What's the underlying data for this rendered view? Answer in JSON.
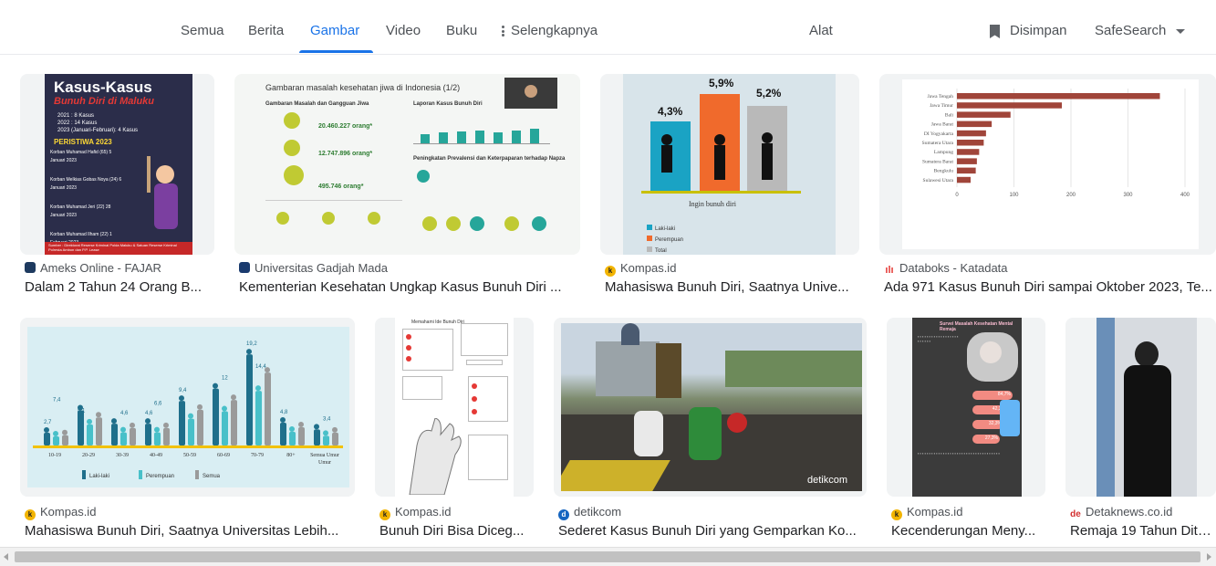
{
  "tabs": [
    {
      "label": "Semua"
    },
    {
      "label": "Berita"
    },
    {
      "label": "Gambar"
    },
    {
      "label": "Video"
    },
    {
      "label": "Buku"
    },
    {
      "label": "Selengkapnya"
    }
  ],
  "tools_label": "Alat",
  "saved_label": "Disimpan",
  "safesearch_label": "SafeSearch",
  "results": [
    {
      "source": "Ameks Online - FAJAR",
      "title": "Dalam 2 Tahun 24 Orang B...",
      "thumb": {
        "heading": "Kasus-Kasus",
        "subheading": "Bunuh Diri di Maluku",
        "lines": [
          "2021 : 8 Kasus",
          "2022 : 14 Kasus",
          "2023 (Januari-Februari): 4 Kasus"
        ],
        "event": "PERISTIWA 2023",
        "items": [
          "Korban Muhamad Hafid (65) 5 Januari 2023",
          "Korban Melkias Gobas Noya (24) 6 Januari 2023",
          "Korban Muhamad Jeri (22) 28 Januari 2023",
          "Korban Muhamad Ilham (22) 1 Februari 2023"
        ],
        "footer": "Sumber : Direktorat Reserse Kriminal Polda Maluku & Satuan Reserse Kriminal Polresta Ambon dan P.P. Lease"
      }
    },
    {
      "source": "Universitas Gadjah Mada",
      "title": "Kementerian Kesehatan Ungkap Kasus Bunuh Diri ...",
      "thumb": {
        "heading": "Gambaran masalah kesehatan jiwa di Indonesia (1/2)",
        "left_title": "Gambaran Masalah dan Gangguan Jiwa",
        "right_title": "Laporan Kasus Bunuh Diri",
        "n1": "20.460.227 orang*",
        "n2": "12.747.896 orang*",
        "n3": "495.746 orang*",
        "mid_title": "Peningkatan Prevalensi dan Keterpaparan terhadap Napza"
      }
    },
    {
      "source": "Kompas.id",
      "title": "Mahasiswa Bunuh Diri, Saatnya Unive...",
      "thumb": {
        "v1": "4,3%",
        "v2": "5,9%",
        "v3": "5,2%",
        "caption": "Ingin bunuh diri",
        "legend": [
          "Laki-laki",
          "Perempuan",
          "Total"
        ]
      }
    },
    {
      "source": "Databoks - Katadata",
      "title": "Ada 971 Kasus Bunuh Diri sampai Oktober 2023, Te...",
      "thumb": {
        "categories": [
          "Jawa Tengah",
          "Jawa Timur",
          "Bali",
          "Jawa Barat",
          "DI Yogyakarta",
          "Sumatera Utara",
          "Lampung",
          "Sumatera Barat",
          "Bengkulu",
          "Sulawesi Utara"
        ],
        "values": [
          356,
          184,
          94,
          61,
          51,
          47,
          39,
          35,
          33,
          24
        ],
        "ticks": [
          "0",
          "100",
          "200",
          "300",
          "400"
        ]
      }
    },
    {
      "source": "Kompas.id",
      "title": "Mahasiswa Bunuh Diri, Saatnya Universitas Lebih...",
      "thumb": {
        "groups": [
          "10-19",
          "20-29",
          "30-39",
          "40-49",
          "50-59",
          "60-69",
          "70-79",
          "80+",
          "Semua Umur"
        ],
        "labels": [
          "2,7",
          "7,4",
          "5,1",
          "4,6",
          "4,6",
          "6,6",
          "9,4",
          "12",
          "19,2",
          "14,4",
          "4,8",
          "3,4"
        ],
        "legend": [
          "Laki-laki",
          "Perempuan",
          "Semua"
        ],
        "axis_label": "Umur"
      }
    },
    {
      "source": "Kompas.id",
      "title": "Bunuh Diri Bisa Diceg...",
      "thumb": {
        "heading": "Memahami Ide Bunuh Diri"
      }
    },
    {
      "source": "detikcom",
      "title": "Sederet Kasus Bunuh Diri yang Gemparkan Ko...",
      "thumb": {
        "watermark": "detikcom"
      }
    },
    {
      "source": "Kompas.id",
      "title": "Kecenderungan Meny...",
      "thumb": {
        "heading": "Survei Masalah Kesehatan Mental Remaja",
        "stats": [
          "84,7%",
          "42,3%",
          "32,3%",
          "27,3%"
        ]
      }
    },
    {
      "source": "Detaknews.co.id",
      "title": "Remaja 19 Tahun Dite..."
    }
  ],
  "colors": {
    "accent": "#1a73e8",
    "text": "#202124",
    "muted": "#4d5156"
  }
}
